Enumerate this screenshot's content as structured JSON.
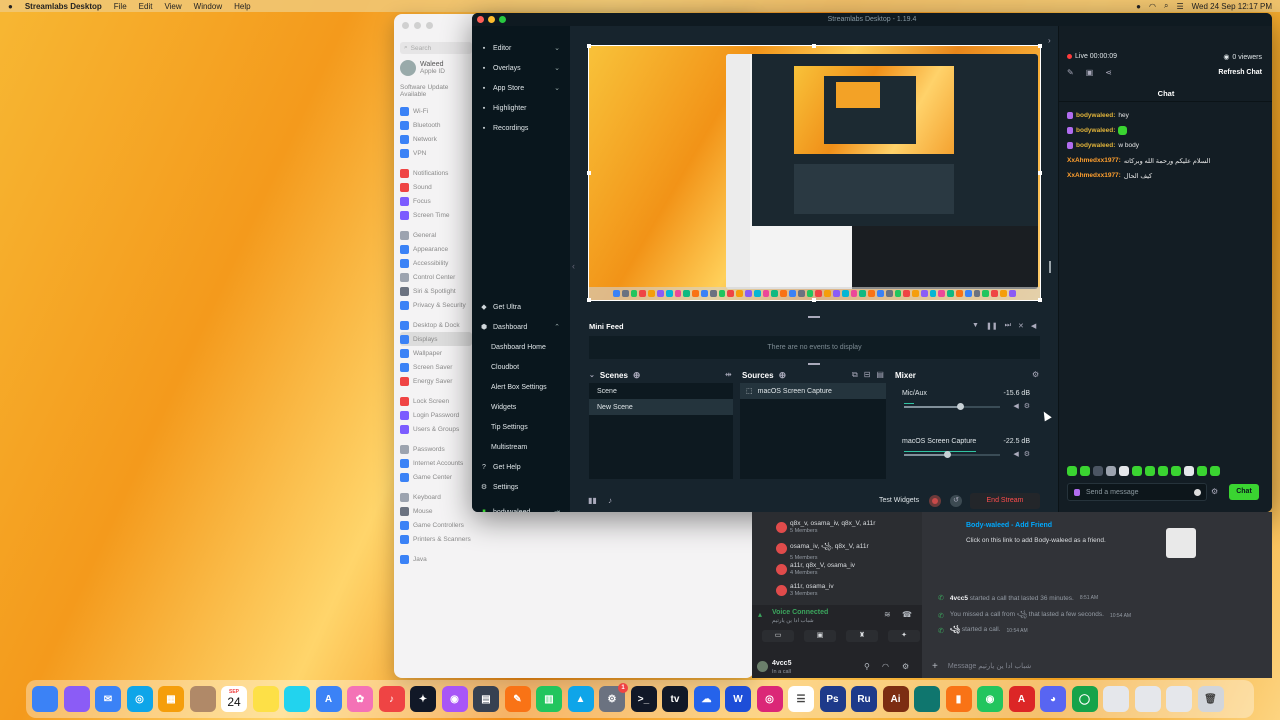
{
  "menubar": {
    "app": "Streamlabs Desktop",
    "menus": [
      "File",
      "Edit",
      "View",
      "Window",
      "Help"
    ],
    "datetime": "Wed 24 Sep  12:17 PM"
  },
  "settings": {
    "search_placeholder": "Search",
    "user_name": "Waleed",
    "user_sub": "Apple ID",
    "update_text": "Software Update Available",
    "groups": [
      [
        "Wi-Fi",
        "Bluetooth",
        "Network",
        "VPN"
      ],
      [
        "Notifications",
        "Sound",
        "Focus",
        "Screen Time"
      ],
      [
        "General",
        "Appearance",
        "Accessibility",
        "Control Center",
        "Siri & Spotlight",
        "Privacy & Security"
      ],
      [
        "Desktop & Dock",
        "Displays",
        "Wallpaper",
        "Screen Saver",
        "Energy Saver"
      ],
      [
        "Lock Screen",
        "Login Password",
        "Users & Groups"
      ],
      [
        "Passwords",
        "Internet Accounts",
        "Game Center"
      ],
      [
        "Keyboard",
        "Mouse",
        "Game Controllers",
        "Printers & Scanners"
      ],
      [
        "Java"
      ]
    ],
    "selected": "Displays"
  },
  "streamlabs": {
    "window_title": "Streamlabs Desktop - 1.19.4",
    "nav_top": [
      {
        "label": "Editor",
        "icon": "editor-icon",
        "chev": "⌄"
      },
      {
        "label": "Overlays",
        "icon": "overlays-icon",
        "chev": "⌄"
      },
      {
        "label": "App Store",
        "icon": "app-store-icon",
        "chev": "⌄"
      },
      {
        "label": "Highlighter",
        "icon": "highlighter-icon",
        "chev": ""
      },
      {
        "label": "Recordings",
        "icon": "recordings-icon",
        "chev": ""
      }
    ],
    "nav_bottom": {
      "get_ultra": "Get Ultra",
      "dashboard": "Dashboard",
      "dashboard_sub": [
        "Dashboard Home",
        "Cloudbot",
        "Alert Box Settings",
        "Widgets",
        "Tip Settings",
        "Multistream"
      ],
      "get_help": "Get Help",
      "settings": "Settings",
      "user": "bodywaleed"
    },
    "minifeed": {
      "title": "Mini Feed",
      "empty": "There are no events to display"
    },
    "scenes": {
      "title": "Scenes",
      "items": [
        "Scene",
        "New Scene"
      ],
      "active": "New Scene"
    },
    "sources": {
      "title": "Sources",
      "items": [
        "macOS Screen Capture"
      ]
    },
    "mixer": {
      "title": "Mixer",
      "channels": [
        {
          "name": "Mic/Aux",
          "db": "-15.6 dB",
          "volume": 0.58,
          "level": 0.1
        },
        {
          "name": "macOS Screen Capture",
          "db": "-22.5 dB",
          "volume": 0.45,
          "level": 0.75
        }
      ]
    },
    "footer": {
      "test_widgets": "Test Widgets",
      "end_stream": "End Stream"
    }
  },
  "chat": {
    "live_time": "Live 00:00:09",
    "viewers": "0 viewers",
    "refresh": "Refresh Chat",
    "title": "Chat",
    "messages": [
      {
        "user": "bodywaleed:",
        "text": "hey",
        "badge": true,
        "emote": false
      },
      {
        "user": "bodywaleed:",
        "text": "",
        "badge": true,
        "emote": true
      },
      {
        "user": "bodywaleed:",
        "text": "w body",
        "badge": true,
        "emote": false
      },
      {
        "user": "XxAhmedxx1977:",
        "text": "السلام عليكم ورحمة الله وبركاته",
        "badge": false,
        "emote": false
      },
      {
        "user": "XxAhmedxx1977:",
        "text": "كيف الحال",
        "badge": false,
        "emote": false
      }
    ],
    "input_placeholder": "Send a message",
    "send_label": "Chat"
  },
  "discord": {
    "dms": [
      {
        "name": "q8x_v, osama_iv, q8x_V, a11r",
        "sub": "5 Members"
      },
      {
        "name": "osama_iv, ꧁, q8x_V, a11r",
        "sub": "5 Members"
      },
      {
        "name": "a11r, q8x_V, osama_iv",
        "sub": "4 Members"
      },
      {
        "name": "a11r, osama_iv",
        "sub": "3 Members"
      }
    ],
    "voice_status": "Voice Connected",
    "voice_channel": "شباب ادا ين يارتيم",
    "user_name": "4vcc5",
    "user_status": "In a call",
    "invite_title": "Body-waleed - Add Friend",
    "invite_desc": "Click on this link to add Body-waleed as a friend.",
    "calls": [
      {
        "who": "4vcc5",
        "text": "started a call that lasted 36 minutes.",
        "time": "8:51 AM"
      },
      {
        "who": "",
        "text": "You missed a call from ꧁ that lasted a few seconds.",
        "time": "10:54 AM"
      },
      {
        "who": "꧁",
        "text": "started a call.",
        "time": "10:54 AM"
      }
    ],
    "message_placeholder": "Message شباب ادا ين يارتيم"
  },
  "dock": {
    "calendar_month": "SEP",
    "calendar_day": "24",
    "badge": "1",
    "labels": {
      "ps": "Ps",
      "ru": "Ru",
      "ai": "Ai"
    }
  }
}
